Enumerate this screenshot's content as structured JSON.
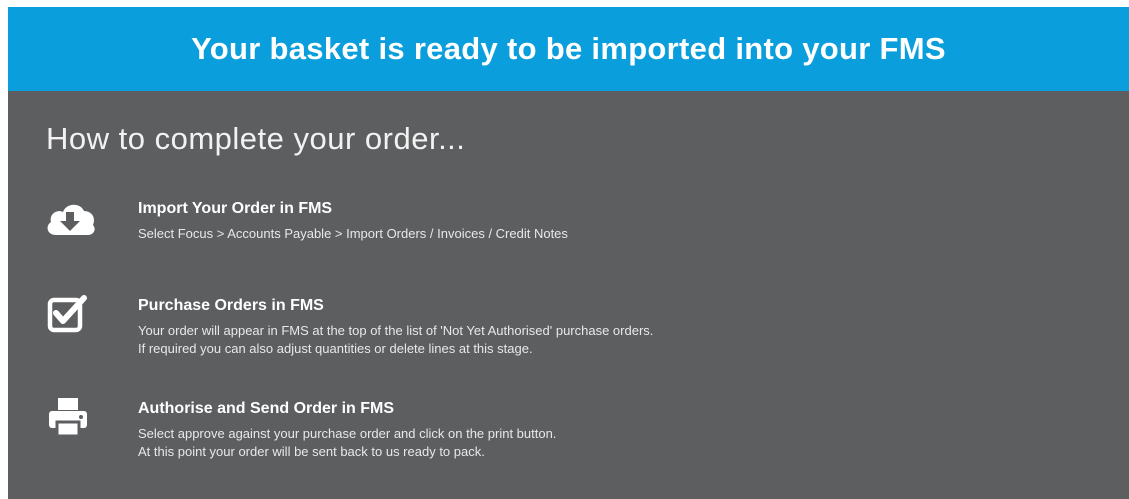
{
  "banner": {
    "title": "Your basket is ready to be imported into your FMS",
    "color": "#0a9fdc"
  },
  "panel": {
    "heading": "How to complete your order...",
    "background": "#5d5e60"
  },
  "steps": [
    {
      "icon": "cloud-download-icon",
      "title": "Import Your Order in FMS",
      "lines": [
        "Select Focus > Accounts Payable > Import Orders / Invoices / Credit Notes"
      ]
    },
    {
      "icon": "checkbox-icon",
      "title": "Purchase Orders in FMS",
      "lines": [
        "Your order will appear in FMS at the top of the list of 'Not Yet Authorised' purchase orders.",
        "If required you can also adjust quantities or delete lines at this stage."
      ]
    },
    {
      "icon": "printer-icon",
      "title": "Authorise and Send Order in FMS",
      "lines": [
        "Select approve against your purchase order and click on the print button.",
        "At this point your order will be sent back to us ready to pack."
      ]
    }
  ]
}
